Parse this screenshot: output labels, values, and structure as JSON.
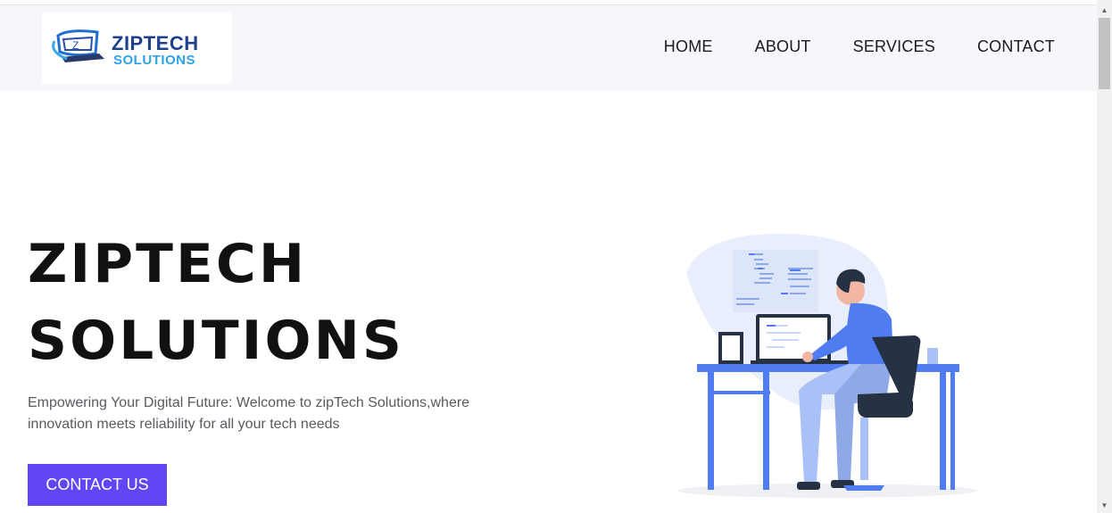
{
  "logo": {
    "line1": "ZIPTECH",
    "line2": "SOLUTIONS",
    "mark_letter": "Z"
  },
  "nav": {
    "items": [
      {
        "label": "HOME"
      },
      {
        "label": "ABOUT"
      },
      {
        "label": "SERVICES"
      },
      {
        "label": "CONTACT"
      }
    ]
  },
  "hero": {
    "title_line1": "ZIPTECH",
    "title_line2": "SOLUTIONS",
    "tagline": "Empowering Your Digital Future: Welcome to zipTech Solutions,where innovation meets reliability for all your tech needs",
    "cta_label": "CONTACT US"
  },
  "colors": {
    "accent": "#6047f3",
    "header_bg": "#f6f6fb",
    "illustration_blue": "#4f7cf0",
    "logo_blue": "#1e6fd0"
  },
  "icons": {
    "scroll_up": "scroll-up-arrow-icon",
    "scroll_down": "scroll-down-arrow-icon"
  }
}
